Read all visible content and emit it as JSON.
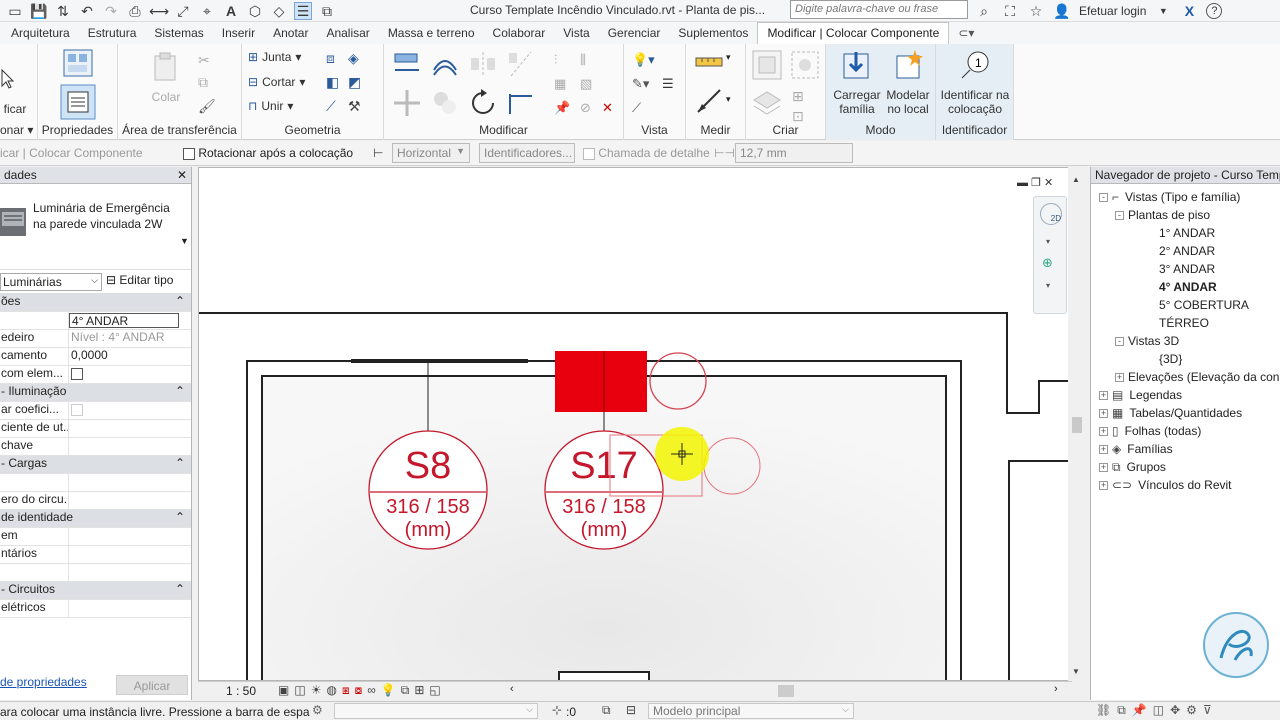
{
  "title_bar": {
    "document_title": "Curso Template Incêndio Vinculado.rvt - Planta de pis...",
    "search_placeholder": "Digite palavra-chave ou frase",
    "login_label": "Efetuar login",
    "help_label": "?"
  },
  "ribbon_tabs": [
    "Arquitetura",
    "Estrutura",
    "Sistemas",
    "Inserir",
    "Anotar",
    "Analisar",
    "Massa e terreno",
    "Colaborar",
    "Vista",
    "Gerenciar",
    "Suplementos",
    "Modificar | Colocar Componente"
  ],
  "ribbon": {
    "select_label": "ficar",
    "select_sub": "onar",
    "properties_label": "Propriedades",
    "clipboard": {
      "paste_label": "Colar",
      "title": "Área de transferência"
    },
    "geometry": {
      "join_label": "Junta",
      "cut_label": "Cortar",
      "unite_label": "Unir",
      "title": "Geometria"
    },
    "modify_title": "Modificar",
    "view_title": "Vista",
    "measure_title": "Medir",
    "create_title": "Criar",
    "mode": {
      "load_family_label": "Carregar família",
      "model_inplace_label": "Modelar no local",
      "title": "Modo"
    },
    "tag": {
      "tag_on_placement_label": "Identificar na colocação",
      "title": "Identificador"
    }
  },
  "options_bar": {
    "context_label": "icar | Colocar Componente",
    "rotate_after_label": "Rotacionar após a colocação",
    "orientation_value": "Horizontal",
    "tags_button": "Identificadores...",
    "leader_label": "Chamada de detalhe",
    "leader_length": "12,7 mm"
  },
  "properties": {
    "header": "dades",
    "type_name": "Luminária de Emergência na parede vinculada 2W",
    "type_filter": "Luminárias",
    "edit_type_label": "Editar tipo",
    "rows": [
      {
        "k": "ões",
        "v": "",
        "group": true
      },
      {
        "k": "",
        "v": "4° ANDAR",
        "boxed": true
      },
      {
        "k": "edeiro",
        "v": "Nível : 4° ANDAR",
        "muted": true
      },
      {
        "k": "camento",
        "v": "0,0000"
      },
      {
        "k": "com elem...",
        "v": "",
        "check": true
      },
      {
        "k": "- Iluminação",
        "v": "",
        "group": true
      },
      {
        "k": "ar coefici...",
        "v": "",
        "check": true,
        "muted": true
      },
      {
        "k": "ciente de ut...",
        "v": ""
      },
      {
        "k": "chave",
        "v": "",
        "muted": true
      },
      {
        "k": "- Cargas",
        "v": "",
        "group": true
      },
      {
        "k": "",
        "v": ""
      },
      {
        "k": "ero do circu...",
        "v": "",
        "muted": true
      },
      {
        "k": "de identidade",
        "v": "",
        "group": true
      },
      {
        "k": "em",
        "v": ""
      },
      {
        "k": "ntários",
        "v": ""
      },
      {
        "k": "",
        "v": ""
      },
      {
        "k": "- Circuitos",
        "v": "",
        "group": true
      },
      {
        "k": "elétricos",
        "v": "",
        "muted": true
      }
    ],
    "help_link": "de propriedades",
    "apply_label": "Aplicar"
  },
  "canvas": {
    "tags": [
      {
        "code": "S8",
        "dims": "316 / 158",
        "unit": "(mm)"
      },
      {
        "code": "S17",
        "dims": "316 / 158",
        "unit": "(mm)"
      }
    ],
    "scale_label": "1 : 50"
  },
  "browser": {
    "header": "Navegador de projeto - Curso Templ",
    "items": [
      {
        "label": "Vistas (Tipo e família)",
        "level": 0,
        "glyph": "-",
        "icon": "views-icon"
      },
      {
        "label": "Plantas de piso",
        "level": 1,
        "glyph": "-"
      },
      {
        "label": "1° ANDAR",
        "level": 2
      },
      {
        "label": "2° ANDAR",
        "level": 2
      },
      {
        "label": "3° ANDAR",
        "level": 2
      },
      {
        "label": "4° ANDAR",
        "level": 2,
        "bold": true
      },
      {
        "label": "5° COBERTURA",
        "level": 2
      },
      {
        "label": "TÉRREO",
        "level": 2
      },
      {
        "label": "Vistas 3D",
        "level": 1,
        "glyph": "-"
      },
      {
        "label": "{3D}",
        "level": 2
      },
      {
        "label": "Elevações (Elevação da con",
        "level": 1,
        "glyph": "+"
      },
      {
        "label": "Legendas",
        "level": 0,
        "glyph": "+",
        "icon": "legend-icon"
      },
      {
        "label": "Tabelas/Quantidades",
        "level": 0,
        "glyph": "+",
        "icon": "schedule-icon"
      },
      {
        "label": "Folhas (todas)",
        "level": 0,
        "glyph": "+",
        "icon": "sheet-icon"
      },
      {
        "label": "Famílias",
        "level": 0,
        "glyph": "+",
        "icon": "family-icon"
      },
      {
        "label": "Grupos",
        "level": 0,
        "glyph": "+",
        "icon": "group-icon"
      },
      {
        "label": "Vínculos do Revit",
        "level": 0,
        "glyph": "+",
        "icon": "link-icon"
      }
    ]
  },
  "status": {
    "message": "ara colocar uma instância livre. Pressione a barra de espa",
    "selection_count": ":0",
    "workset": "Modelo principal"
  },
  "colors": {
    "accent_red": "#e8000f",
    "tag_line": "#c4172c",
    "cursor_highlight": "#f3f400"
  }
}
